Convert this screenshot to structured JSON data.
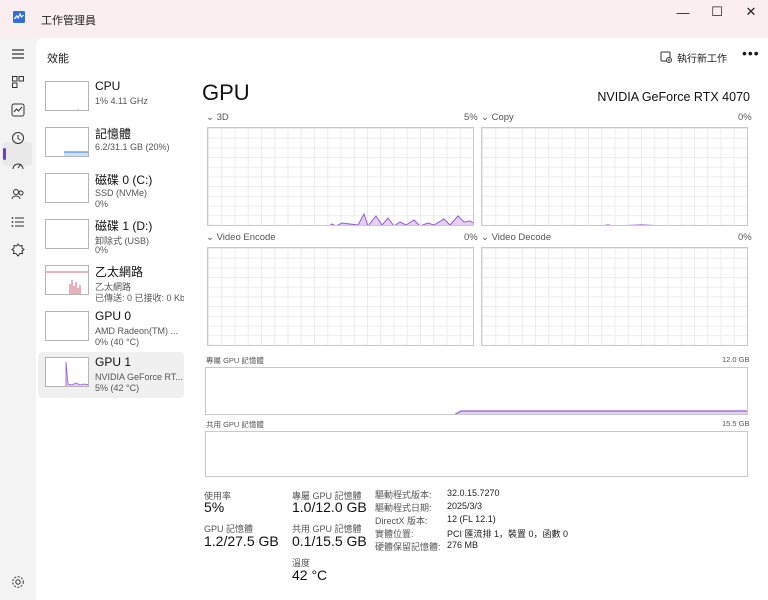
{
  "app": {
    "title": "工作管理員"
  },
  "window": {
    "minimize": "—",
    "maximize": "☐",
    "close": "✕"
  },
  "nav": {
    "icons": [
      "hamburger-icon",
      "processes-icon",
      "performance-icon",
      "app-history-icon",
      "startup-icon",
      "users-icon",
      "details-icon",
      "services-icon",
      "settings-icon"
    ],
    "selected": "performance-icon",
    "accent": "#7a3bb8"
  },
  "header": {
    "page_title": "效能",
    "run_task": "執行新工作",
    "more": "•••"
  },
  "devices": [
    {
      "name": "CPU",
      "sub1": "1%  4.11 GHz",
      "sub2": ""
    },
    {
      "name": "記憶體",
      "sub1": "6.2/31.1 GB (20%)",
      "sub2": ""
    },
    {
      "name": "磁碟 0 (C:)",
      "sub1": "SSD (NVMe)",
      "sub2": "0%"
    },
    {
      "name": "磁碟 1 (D:)",
      "sub1": "卸除式 (USB)",
      "sub2": "0%"
    },
    {
      "name": "乙太網路",
      "sub1": "乙太網路",
      "sub2": "已傳送: 0 已接收: 0 Kbps"
    },
    {
      "name": "GPU 0",
      "sub1": "AMD Radeon(TM) ...",
      "sub2": "0% (40 °C)"
    },
    {
      "name": "GPU 1",
      "sub1": "NVIDIA GeForce RT...",
      "sub2": "5% (42 °C)"
    }
  ],
  "gpu": {
    "title": "GPU",
    "model": "NVIDIA GeForce RTX 4070",
    "engines": [
      {
        "name": "3D",
        "pct": "5%"
      },
      {
        "name": "Copy",
        "pct": "0%"
      },
      {
        "name": "Video Encode",
        "pct": "0%"
      },
      {
        "name": "Video Decode",
        "pct": "0%"
      }
    ],
    "dedicated_label": "專屬 GPU 記憶體",
    "dedicated_max": "12.0 GB",
    "shared_label": "共用 GPU 記憶體",
    "shared_max": "15.5 GB",
    "graph_line_color": "#9b59d0",
    "graph_fill_color": "#e3d1f3"
  },
  "stats": {
    "utilization_label": "使用率",
    "utilization": "5%",
    "gpu_mem_label": "GPU 記憶體",
    "gpu_mem": "1.2/27.5 GB",
    "dedicated_label": "專屬 GPU 記憶體",
    "dedicated": "1.0/12.0 GB",
    "shared_label": "共用 GPU 記憶體",
    "shared": "0.1/15.5 GB",
    "temp_label": "溫度",
    "temp": "42 °C"
  },
  "info": [
    {
      "key": "驅動程式版本:",
      "value": "32.0.15.7270"
    },
    {
      "key": "驅動程式日期:",
      "value": "2025/3/3"
    },
    {
      "key": "DirectX 版本:",
      "value": "12 (FL 12.1)"
    },
    {
      "key": "實體位置:",
      "value": "PCI 匯流排 1，裝置 0，函數 0"
    },
    {
      "key": "硬體保留記憶體:",
      "value": "276 MB"
    }
  ]
}
